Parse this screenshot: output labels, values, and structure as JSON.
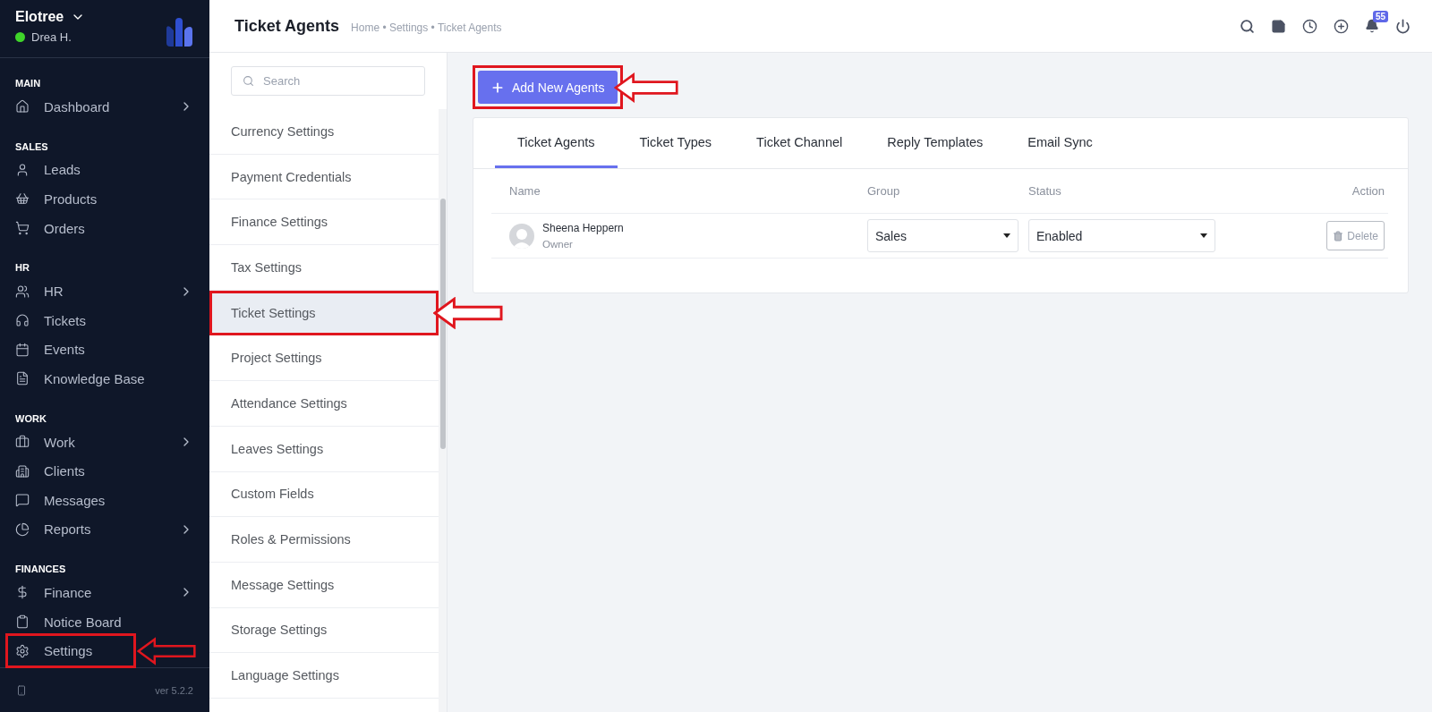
{
  "sidebar": {
    "company": "Elotree",
    "user": {
      "name": "Drea H.",
      "online": true
    },
    "sections": [
      {
        "label": "MAIN",
        "items": [
          {
            "label": "Dashboard",
            "has_submenu": true,
            "annotated": false
          }
        ]
      },
      {
        "label": "SALES",
        "items": [
          {
            "label": "Leads",
            "has_submenu": false,
            "annotated": false
          },
          {
            "label": "Products",
            "has_submenu": false,
            "annotated": false
          },
          {
            "label": "Orders",
            "has_submenu": false,
            "annotated": false
          }
        ]
      },
      {
        "label": "HR",
        "items": [
          {
            "label": "HR",
            "has_submenu": true,
            "annotated": false
          },
          {
            "label": "Tickets",
            "has_submenu": false,
            "annotated": false
          },
          {
            "label": "Events",
            "has_submenu": false,
            "annotated": false
          },
          {
            "label": "Knowledge Base",
            "has_submenu": false,
            "annotated": false
          }
        ]
      },
      {
        "label": "WORK",
        "items": [
          {
            "label": "Work",
            "has_submenu": true,
            "annotated": false
          },
          {
            "label": "Clients",
            "has_submenu": false,
            "annotated": false
          },
          {
            "label": "Messages",
            "has_submenu": false,
            "annotated": false
          },
          {
            "label": "Reports",
            "has_submenu": true,
            "annotated": false
          }
        ]
      },
      {
        "label": "FINANCES",
        "items": [
          {
            "label": "Finance",
            "has_submenu": true,
            "annotated": false
          },
          {
            "label": "Notice Board",
            "has_submenu": false,
            "annotated": false
          },
          {
            "label": "Settings",
            "has_submenu": false,
            "annotated": true
          }
        ]
      }
    ],
    "version": "ver 5.2.2"
  },
  "header": {
    "title": "Ticket Agents",
    "breadcrumb": "Home • Settings • Ticket Agents",
    "notification_count": "55"
  },
  "settings_menu": {
    "search": {
      "placeholder": "Search"
    },
    "items": [
      {
        "label": "Currency Settings",
        "selected": false,
        "annotated": false
      },
      {
        "label": "Payment Credentials",
        "selected": false,
        "annotated": false
      },
      {
        "label": "Finance Settings",
        "selected": false,
        "annotated": false
      },
      {
        "label": "Tax Settings",
        "selected": false,
        "annotated": false
      },
      {
        "label": "Ticket Settings",
        "selected": true,
        "annotated": true
      },
      {
        "label": "Project Settings",
        "selected": false,
        "annotated": false
      },
      {
        "label": "Attendance Settings",
        "selected": false,
        "annotated": false
      },
      {
        "label": "Leaves Settings",
        "selected": false,
        "annotated": false
      },
      {
        "label": "Custom Fields",
        "selected": false,
        "annotated": false
      },
      {
        "label": "Roles & Permissions",
        "selected": false,
        "annotated": false
      },
      {
        "label": "Message Settings",
        "selected": false,
        "annotated": false
      },
      {
        "label": "Storage Settings",
        "selected": false,
        "annotated": false
      },
      {
        "label": "Language Settings",
        "selected": false,
        "annotated": false
      }
    ]
  },
  "add_button": {
    "label": "Add New Agents",
    "annotated": true
  },
  "tabs": [
    {
      "label": "Ticket Agents",
      "selected": true
    },
    {
      "label": "Ticket Types",
      "selected": false
    },
    {
      "label": "Ticket Channel",
      "selected": false
    },
    {
      "label": "Reply Templates",
      "selected": false
    },
    {
      "label": "Email Sync",
      "selected": false
    }
  ],
  "table": {
    "columns": [
      "Name",
      "Group",
      "Status",
      "Action"
    ],
    "rows": [
      {
        "name": "Sheena Heppern",
        "role": "Owner",
        "group": "Sales",
        "status": "Enabled",
        "action": "Delete"
      }
    ]
  }
}
